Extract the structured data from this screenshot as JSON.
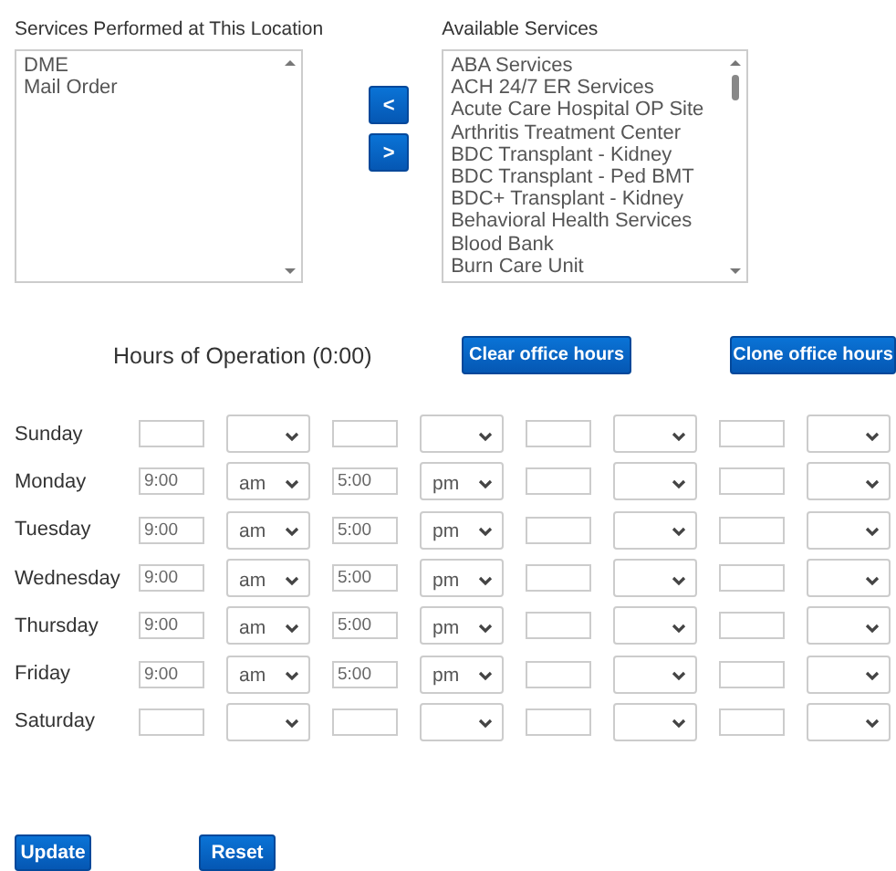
{
  "services_performed": {
    "label": "Services Performed at This Location",
    "items": [
      "DME",
      "Mail Order"
    ]
  },
  "move_buttons": [
    "<",
    ">"
  ],
  "available_services": {
    "label": "Available Services",
    "items": [
      "ABA Services",
      "ACH 24/7 ER Services",
      "Acute Care Hospital OP Site",
      "Arthritis Treatment Center",
      "BDC Transplant - Kidney",
      "BDC Transplant - Ped BMT",
      "BDC+ Transplant - Kidney",
      "Behavioral Health Services",
      "Blood Bank",
      "Burn Care Unit"
    ]
  },
  "hours": {
    "title": "Hours of Operation (0:00)",
    "buttons": [
      "Clear office hours",
      "Clone office hours"
    ],
    "days": [
      {
        "day": "Sunday",
        "slots": [
          {
            "kind": "blank"
          },
          {
            "kind": "blank"
          },
          {
            "kind": "blank"
          },
          {
            "kind": "blank"
          }
        ]
      },
      {
        "day": "Monday",
        "slots": [
          {
            "kind": "filled",
            "time": "9:00",
            "period": "am"
          },
          {
            "kind": "filled",
            "time": "5:00",
            "period": "pm"
          },
          {
            "kind": "blank"
          },
          {
            "kind": "blank"
          }
        ]
      },
      {
        "day": "Tuesday",
        "slots": [
          {
            "kind": "filled",
            "time": "9:00",
            "period": "am"
          },
          {
            "kind": "filled",
            "time": "5:00",
            "period": "pm"
          },
          {
            "kind": "blank"
          },
          {
            "kind": "blank"
          }
        ]
      },
      {
        "day": "Wednesday",
        "slots": [
          {
            "kind": "filled",
            "time": "9:00",
            "period": "am"
          },
          {
            "kind": "filled",
            "time": "5:00",
            "period": "pm"
          },
          {
            "kind": "blank"
          },
          {
            "kind": "blank"
          }
        ]
      },
      {
        "day": "Thursday",
        "slots": [
          {
            "kind": "filled",
            "time": "9:00",
            "period": "am"
          },
          {
            "kind": "filled",
            "time": "5:00",
            "period": "pm"
          },
          {
            "kind": "blank"
          },
          {
            "kind": "blank"
          }
        ]
      },
      {
        "day": "Friday",
        "slots": [
          {
            "kind": "filled",
            "time": "9:00",
            "period": "am"
          },
          {
            "kind": "filled",
            "time": "5:00",
            "period": "pm"
          },
          {
            "kind": "blank"
          },
          {
            "kind": "blank"
          }
        ]
      },
      {
        "day": "Saturday",
        "slots": [
          {
            "kind": "blank"
          },
          {
            "kind": "blank"
          },
          {
            "kind": "blank"
          },
          {
            "kind": "blank"
          }
        ]
      }
    ]
  },
  "footer_buttons": [
    "Update",
    "Reset"
  ]
}
